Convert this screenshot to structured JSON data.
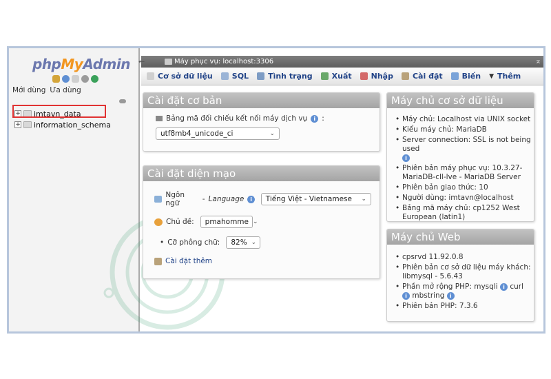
{
  "nav": {
    "logo_php": "php",
    "logo_my": "My",
    "logo_admin": "Admin",
    "tab_recent": "Mới dùng",
    "tab_favorites": "Ưa dùng",
    "databases": [
      "imtavn_data",
      "information_schema"
    ]
  },
  "topbar": {
    "server_label": "Máy phục vụ: localhost:3306"
  },
  "menu": {
    "databases": "Cơ sở dữ liệu",
    "sql": "SQL",
    "status": "Tình trạng",
    "export": "Xuất",
    "import": "Nhập",
    "settings": "Cài đặt",
    "variables": "Biến",
    "more": "Thêm"
  },
  "general": {
    "title": "Cài đặt cơ bản",
    "collation_label": "Bảng mã đối chiếu kết nối máy dịch vụ",
    "collation_value": "utf8mb4_unicode_ci"
  },
  "appearance": {
    "title": "Cài đặt diện mạo",
    "language_label": "Ngôn ngữ",
    "language_label_en": "Language",
    "language_value": "Tiếng Việt - Vietnamese",
    "theme_label": "Chủ đề:",
    "theme_value": "pmahomme",
    "fontsize_label": "Cỡ phông chữ:",
    "fontsize_value": "82%",
    "more_settings": "Cài đặt thêm"
  },
  "db_server": {
    "title": "Máy chủ cơ sở dữ liệu",
    "items": [
      "Máy chủ: Localhost via UNIX socket",
      "Kiểu máy chủ: MariaDB",
      "Server connection: SSL is not being used",
      "Phiên bản máy phục vụ: 10.3.27-MariaDB-cll-lve - MariaDB Server",
      "Phiên bản giao thức: 10",
      "Người dùng: imtavn@localhost",
      "Bảng mã máy chủ: cp1252 West European (latin1)"
    ]
  },
  "web_server": {
    "title": "Máy chủ Web",
    "items": [
      "cpsrvd 11.92.0.8",
      "Phiên bản cơ sở dữ liệu máy khách: libmysql - 5.6.43",
      "Phần mở rộng PHP: mysqli",
      "curl",
      "mbstring",
      "Phiên bản PHP: 7.3.6"
    ]
  },
  "colors": {
    "logo_blue": "#6c78ae",
    "logo_orange": "#f29620",
    "panel_header": "#b0b0b0",
    "highlight": "#e03232",
    "link": "#224488"
  }
}
